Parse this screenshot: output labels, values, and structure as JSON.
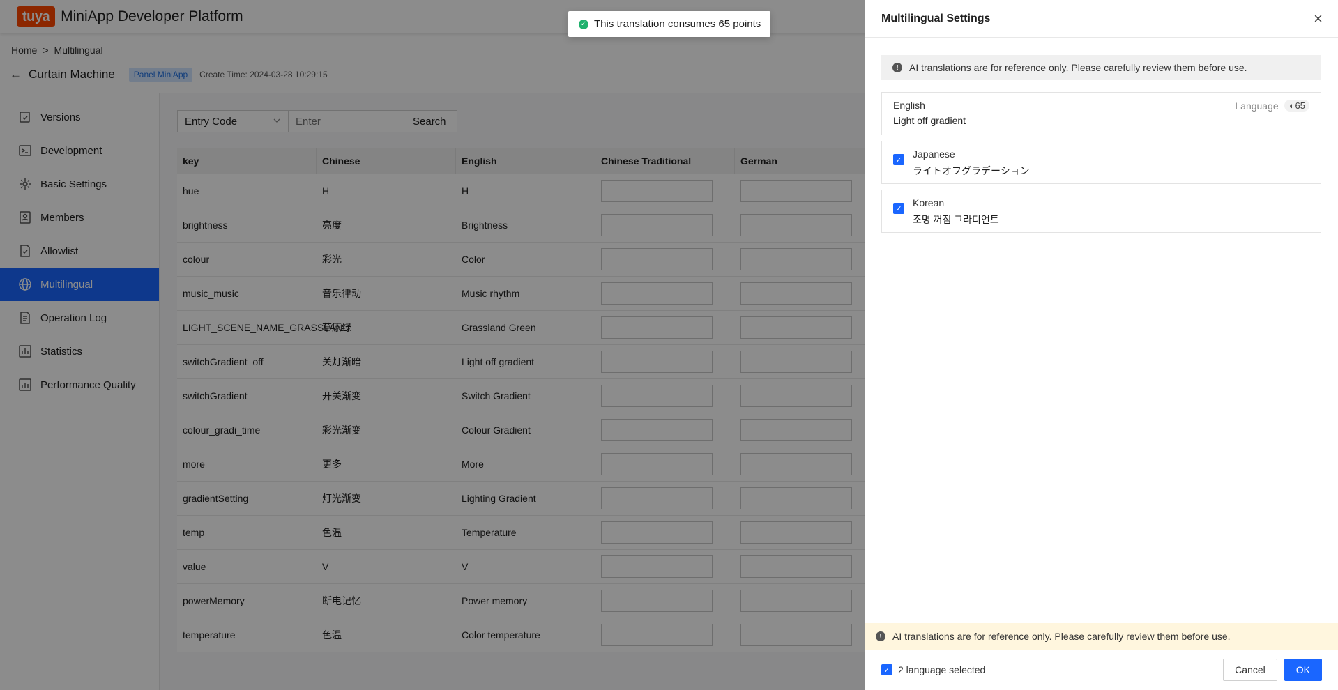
{
  "header": {
    "logo": "tuya",
    "title": "MiniApp Developer Platform"
  },
  "breadcrumb": {
    "home": "Home",
    "sep": ">",
    "current": "Multilingual"
  },
  "app": {
    "back": "←",
    "name": "Curtain Machine",
    "badge": "Panel MiniApp",
    "create_time": "Create Time: 2024-03-28 10:29:15"
  },
  "sidebar": {
    "items": [
      {
        "label": "Versions",
        "icon": "versions-icon"
      },
      {
        "label": "Development",
        "icon": "terminal-icon"
      },
      {
        "label": "Basic Settings",
        "icon": "gear-icon"
      },
      {
        "label": "Members",
        "icon": "members-icon"
      },
      {
        "label": "Allowlist",
        "icon": "allowlist-icon"
      },
      {
        "label": "Multilingual",
        "icon": "globe-icon",
        "active": true
      },
      {
        "label": "Operation Log",
        "icon": "log-icon"
      },
      {
        "label": "Statistics",
        "icon": "statistics-icon"
      },
      {
        "label": "Performance Quality",
        "icon": "performance-icon"
      }
    ]
  },
  "search": {
    "select_value": "Entry Code",
    "placeholder": "Enter",
    "button": "Search"
  },
  "table": {
    "columns": [
      "key",
      "Chinese",
      "English",
      "Chinese Traditional",
      "German"
    ],
    "rows": [
      {
        "key": "hue",
        "zh": "H",
        "en": "H"
      },
      {
        "key": "brightness",
        "zh": "亮度",
        "en": "Brightness"
      },
      {
        "key": "colour",
        "zh": "彩光",
        "en": "Color"
      },
      {
        "key": "music_music",
        "zh": "音乐律动",
        "en": "Music rhythm"
      },
      {
        "key": "LIGHT_SCENE_NAME_GRASSLAND",
        "zh": "草原绿",
        "en": "Grassland Green"
      },
      {
        "key": "switchGradient_off",
        "zh": "关灯渐暗",
        "en": "Light off gradient"
      },
      {
        "key": "switchGradient",
        "zh": "开关渐变",
        "en": "Switch Gradient"
      },
      {
        "key": "colour_gradi_time",
        "zh": "彩光渐变",
        "en": "Colour Gradient"
      },
      {
        "key": "more",
        "zh": "更多",
        "en": "More"
      },
      {
        "key": "gradientSetting",
        "zh": "灯光渐变",
        "en": "Lighting Gradient"
      },
      {
        "key": "temp",
        "zh": "色温",
        "en": "Temperature"
      },
      {
        "key": "value",
        "zh": "V",
        "en": "V"
      },
      {
        "key": "powerMemory",
        "zh": "断电记忆",
        "en": "Power memory"
      },
      {
        "key": "temperature",
        "zh": "色温",
        "en": "Color temperature"
      }
    ]
  },
  "toast": {
    "text": "This translation consumes 65 points"
  },
  "drawer": {
    "title": "Multilingual Settings",
    "info": "AI translations are for reference only. Please carefully review them before use.",
    "source": {
      "lang": "English",
      "text": "Light off gradient",
      "lang_label": "Language",
      "points": "65"
    },
    "targets": [
      {
        "lang": "Japanese",
        "text": "ライトオフグラデーション",
        "checked": true
      },
      {
        "lang": "Korean",
        "text": "조명 꺼짐 그라디언트",
        "checked": true
      }
    ],
    "warning": "AI translations are for reference only. Please carefully review them before use.",
    "selected": "2 language selected",
    "cancel": "Cancel",
    "ok": "OK"
  },
  "colors": {
    "primary": "#1a66ff",
    "brand": "#ff4800",
    "success": "#1fb16d",
    "warning_bg": "#fff6de"
  }
}
